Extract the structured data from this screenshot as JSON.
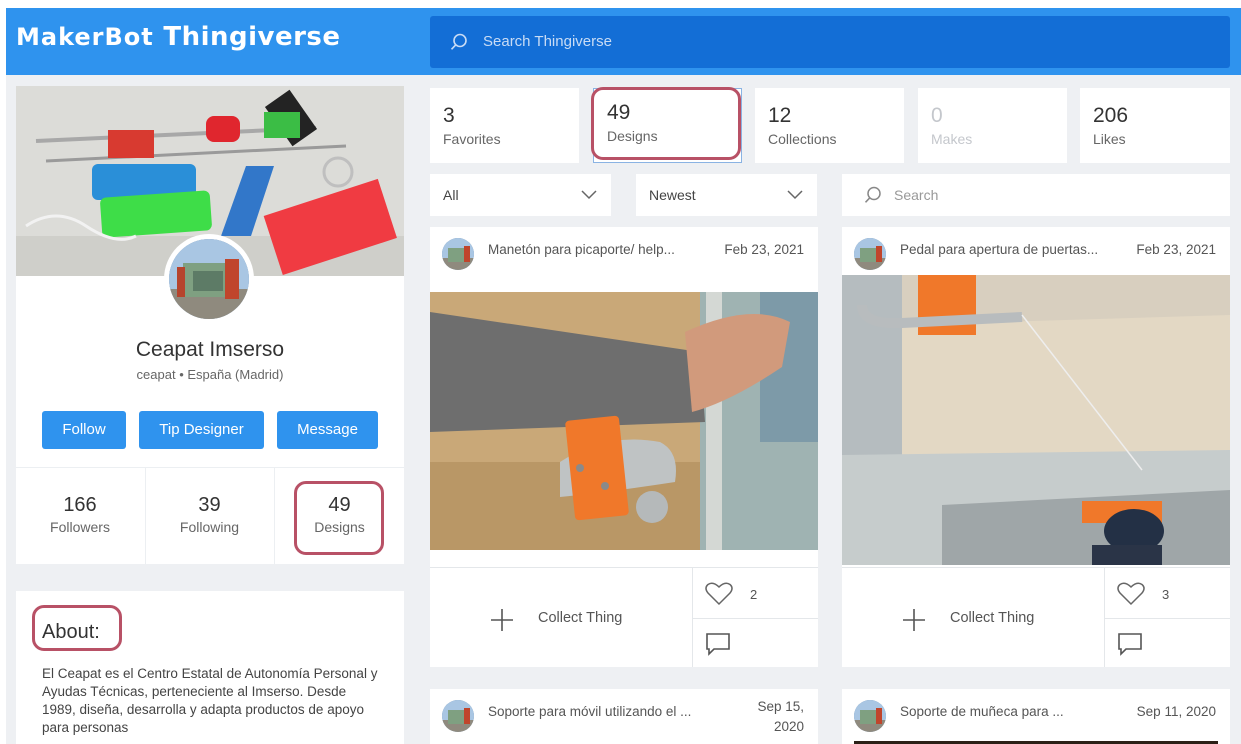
{
  "header": {
    "logo_maker": "MakerBot",
    "logo_thingiverse": "Thingiverse",
    "search_placeholder": "Search Thingiverse"
  },
  "profile": {
    "name": "Ceapat Imserso",
    "subtitle": "ceapat • España (Madrid)",
    "buttons": {
      "follow": "Follow",
      "tip": "Tip Designer",
      "message": "Message"
    },
    "stats": [
      {
        "value": "166",
        "label": "Followers"
      },
      {
        "value": "39",
        "label": "Following"
      },
      {
        "value": "49",
        "label": "Designs"
      }
    ],
    "about_title": "About:",
    "about_text": "El Ceapat es el Centro Estatal de Autonomía Personal y Ayudas Técnicas, perteneciente al Imserso. Desde 1989, diseña, desarrolla y adapta productos de apoyo para personas"
  },
  "tabs": [
    {
      "value": "3",
      "label": "Favorites"
    },
    {
      "value": "49",
      "label": "Designs"
    },
    {
      "value": "12",
      "label": "Collections"
    },
    {
      "value": "0",
      "label": "Makes"
    },
    {
      "value": "206",
      "label": "Likes"
    }
  ],
  "filters": {
    "type": "All",
    "sort": "Newest",
    "search_placeholder": "Search"
  },
  "things": [
    {
      "title": "Manetón para picaporte/ help...",
      "date": "Feb 23, 2021",
      "collect": "Collect Thing",
      "likes": "2"
    },
    {
      "title": "Pedal para apertura de puertas...",
      "date": "Feb 23, 2021",
      "collect": "Collect Thing",
      "likes": "3"
    },
    {
      "title": "Soporte para móvil utilizando el ...",
      "date_line1": "Sep 15,",
      "date_line2": "2020"
    },
    {
      "title": "Soporte de muñeca para ...",
      "date": "Sep 11, 2020"
    }
  ],
  "colors": {
    "brand_blue": "#2f93ee",
    "search_blue": "#136ed6",
    "highlight": "#b85166"
  }
}
